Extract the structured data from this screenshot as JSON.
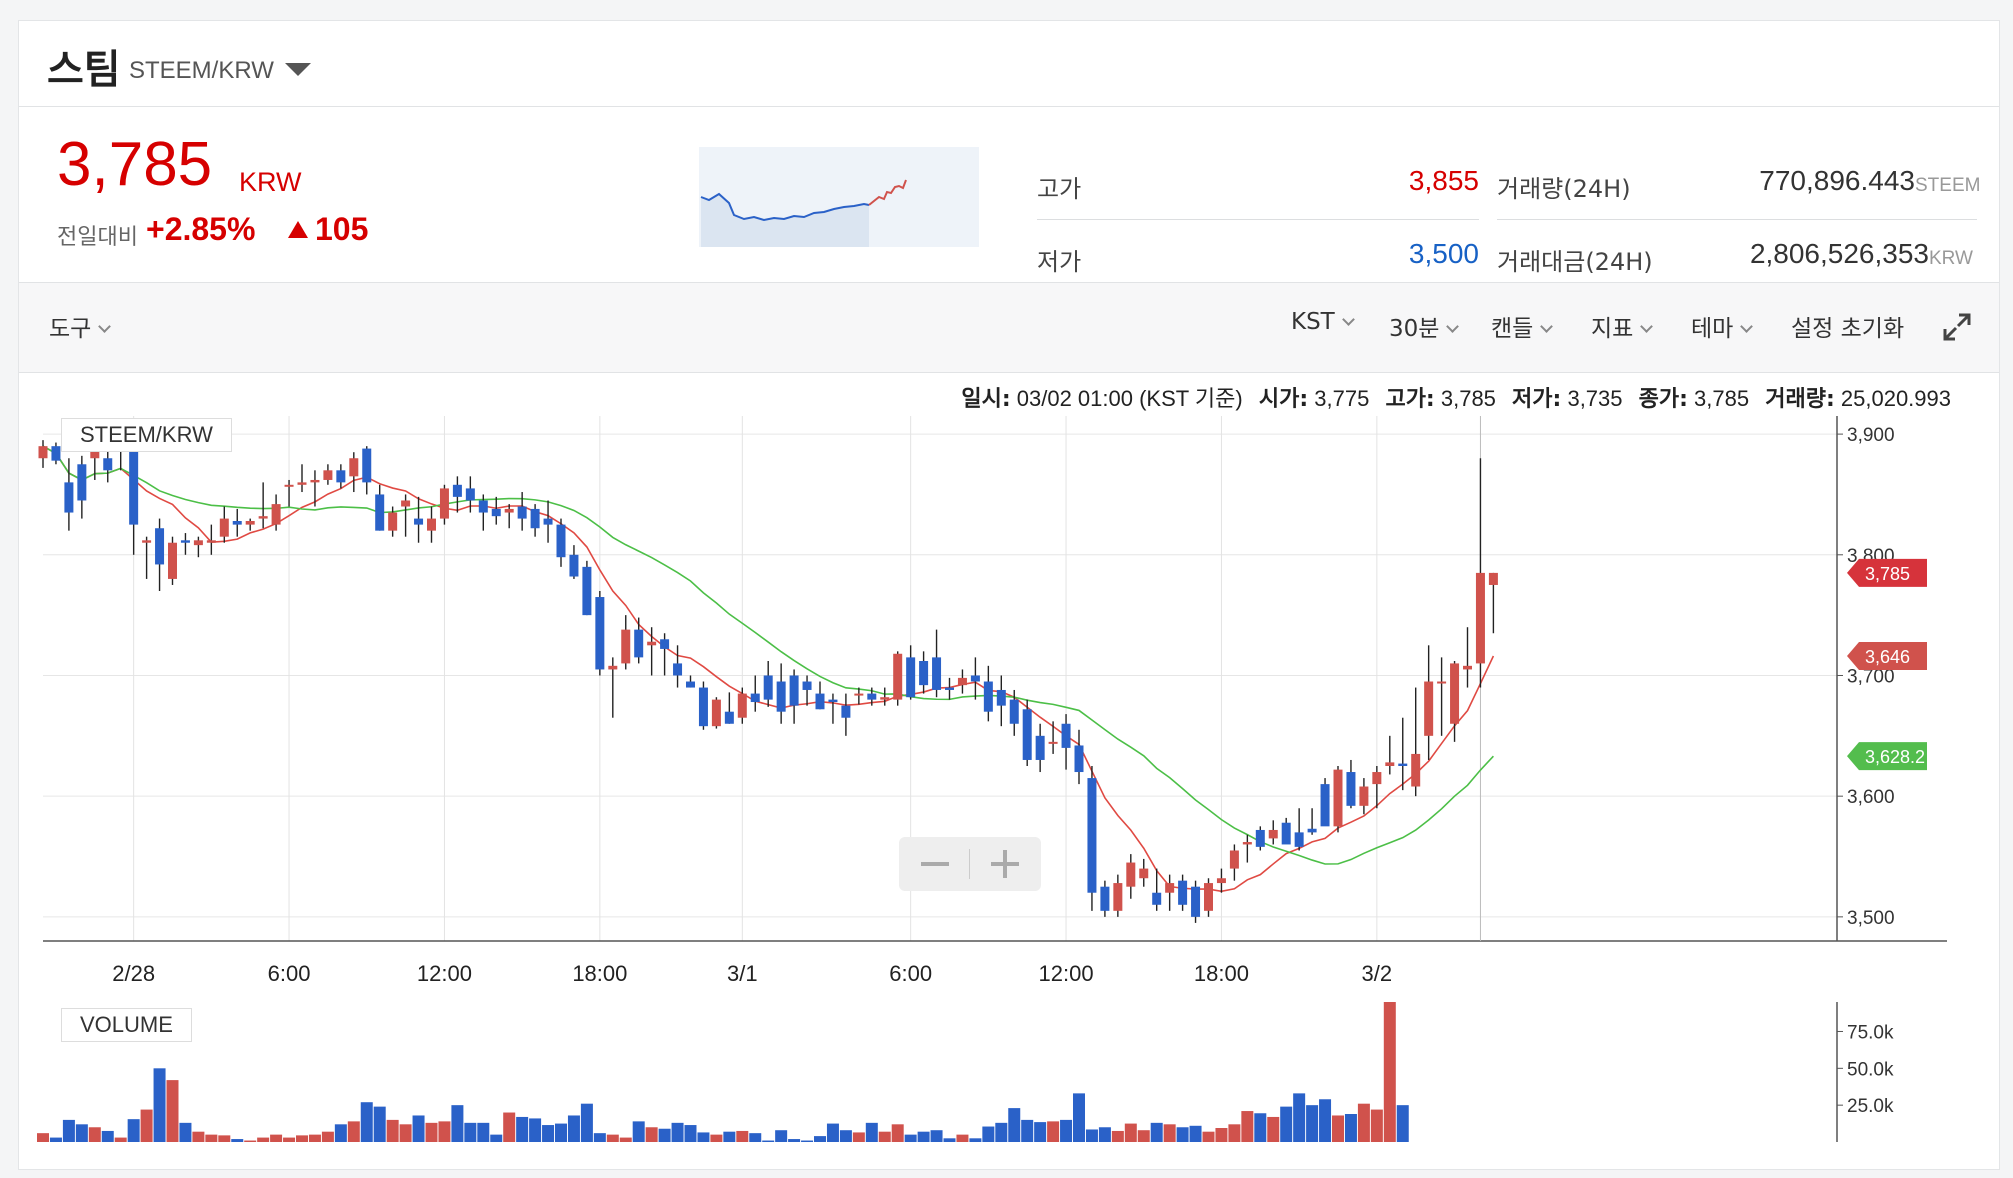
{
  "header": {
    "coin_name": "스팀",
    "pair": "STEEM/KRW"
  },
  "summary": {
    "price": "3,785",
    "unit": "KRW",
    "change_label": "전일대비",
    "change_rate": "+2.85%",
    "change_amount": "105",
    "high_label": "고가",
    "high_value": "3,855",
    "low_label": "저가",
    "low_value": "3,500",
    "volume_label": "거래량(24H)",
    "volume_value": "770,896.443",
    "volume_unit": "STEEM",
    "amount_label": "거래대금(24H)",
    "amount_value": "2,806,526,353",
    "amount_unit": "KRW"
  },
  "toolbar": {
    "tools": "도구",
    "timezone": "KST",
    "interval": "30분",
    "chart_type": "캔들",
    "indicator": "지표",
    "theme": "테마",
    "reset": "설정 초기화"
  },
  "info": {
    "date_label": "일시:",
    "date_value": "03/02 01:00 (KST 기준)",
    "open_label": "시가:",
    "open_value": "3,775",
    "high_label": "고가:",
    "high_value": "3,785",
    "low_label": "저가:",
    "low_value": "3,735",
    "close_label": "종가:",
    "close_value": "3,785",
    "volume_label": "거래량:",
    "volume_value": "25,020.993"
  },
  "legends": {
    "price": "STEEM/KRW",
    "volume": "VOLUME"
  },
  "colors": {
    "up": "#d0524c",
    "down": "#2a61c8",
    "ma_short": "#e04a43",
    "ma_long": "#4cbf47",
    "price_tag": "#d6333b",
    "ma_short_tag": "#d0524c",
    "ma_long_tag": "#53bd4d"
  },
  "chart_data": {
    "type": "candlestick",
    "price_axis": {
      "ylim": [
        3480,
        3915
      ],
      "ticks": [
        3500,
        3600,
        3700,
        3800,
        3900
      ],
      "tick_labels": [
        "3,500",
        "3,600",
        "3,700",
        "3,800",
        "3,900"
      ]
    },
    "x_ticks": [
      {
        "label": "2/28",
        "index": 7
      },
      {
        "label": "6:00",
        "index": 19
      },
      {
        "label": "12:00",
        "index": 31
      },
      {
        "label": "18:00",
        "index": 43
      },
      {
        "label": "3/1",
        "index": 54
      },
      {
        "label": "6:00",
        "index": 67
      },
      {
        "label": "12:00",
        "index": 79
      },
      {
        "label": "18:00",
        "index": 91
      },
      {
        "label": "3/2",
        "index": 103
      }
    ],
    "last_price_tag": "3,785",
    "ma_tags": [
      {
        "name": "MA short",
        "value": "3,646"
      },
      {
        "name": "MA long",
        "value": "3,628.2"
      }
    ],
    "volume_axis": {
      "ylim": [
        0,
        95000
      ],
      "ticks": [
        25000,
        50000,
        75000
      ],
      "tick_labels": [
        "25.0k",
        "50.0k",
        "75.0k"
      ]
    },
    "candles": [
      [
        3880,
        3895,
        3872,
        3890
      ],
      [
        3890,
        3893,
        3875,
        3878
      ],
      [
        3860,
        3880,
        3820,
        3835
      ],
      [
        3875,
        3882,
        3830,
        3845
      ],
      [
        3880,
        3890,
        3862,
        3888
      ],
      [
        3880,
        3895,
        3860,
        3870
      ],
      [
        3890,
        3900,
        3870,
        3895
      ],
      [
        3890,
        3895,
        3800,
        3825
      ],
      [
        3810,
        3815,
        3780,
        3812
      ],
      [
        3822,
        3830,
        3770,
        3792
      ],
      [
        3780,
        3815,
        3775,
        3810
      ],
      [
        3812,
        3818,
        3800,
        3810
      ],
      [
        3808,
        3815,
        3798,
        3812
      ],
      [
        3810,
        3825,
        3800,
        3812
      ],
      [
        3815,
        3840,
        3810,
        3830
      ],
      [
        3828,
        3838,
        3815,
        3825
      ],
      [
        3825,
        3830,
        3820,
        3828
      ],
      [
        3830,
        3860,
        3822,
        3832
      ],
      [
        3825,
        3850,
        3820,
        3842
      ],
      [
        3858,
        3862,
        3840,
        3858
      ],
      [
        3858,
        3875,
        3852,
        3860
      ],
      [
        3860,
        3870,
        3840,
        3862
      ],
      [
        3862,
        3875,
        3858,
        3870
      ],
      [
        3870,
        3875,
        3855,
        3860
      ],
      [
        3865,
        3885,
        3852,
        3880
      ],
      [
        3888,
        3890,
        3850,
        3860
      ],
      [
        3850,
        3858,
        3820,
        3820
      ],
      [
        3820,
        3840,
        3815,
        3835
      ],
      [
        3840,
        3850,
        3815,
        3845
      ],
      [
        3830,
        3848,
        3810,
        3825
      ],
      [
        3820,
        3840,
        3810,
        3830
      ],
      [
        3830,
        3858,
        3825,
        3855
      ],
      [
        3858,
        3865,
        3835,
        3848
      ],
      [
        3855,
        3865,
        3835,
        3845
      ],
      [
        3845,
        3850,
        3820,
        3835
      ],
      [
        3838,
        3848,
        3825,
        3832
      ],
      [
        3835,
        3842,
        3822,
        3838
      ],
      [
        3840,
        3852,
        3820,
        3830
      ],
      [
        3838,
        3842,
        3815,
        3822
      ],
      [
        3830,
        3845,
        3810,
        3825
      ],
      [
        3825,
        3830,
        3790,
        3798
      ],
      [
        3800,
        3808,
        3780,
        3782
      ],
      [
        3790,
        3795,
        3750,
        3750
      ],
      [
        3765,
        3770,
        3700,
        3705
      ],
      [
        3705,
        3715,
        3665,
        3708
      ],
      [
        3710,
        3750,
        3705,
        3738
      ],
      [
        3738,
        3748,
        3710,
        3715
      ],
      [
        3725,
        3740,
        3700,
        3728
      ],
      [
        3730,
        3735,
        3700,
        3722
      ],
      [
        3710,
        3725,
        3690,
        3700
      ],
      [
        3695,
        3700,
        3690,
        3690
      ],
      [
        3690,
        3695,
        3655,
        3658
      ],
      [
        3658,
        3682,
        3656,
        3680
      ],
      [
        3670,
        3686,
        3660,
        3660
      ],
      [
        3665,
        3690,
        3660,
        3685
      ],
      [
        3685,
        3700,
        3670,
        3678
      ],
      [
        3700,
        3712,
        3674,
        3680
      ],
      [
        3695,
        3710,
        3660,
        3670
      ],
      [
        3700,
        3705,
        3660,
        3675
      ],
      [
        3695,
        3700,
        3675,
        3688
      ],
      [
        3685,
        3695,
        3672,
        3672
      ],
      [
        3680,
        3685,
        3660,
        3678
      ],
      [
        3675,
        3685,
        3650,
        3665
      ],
      [
        3685,
        3690,
        3676,
        3685
      ],
      [
        3685,
        3690,
        3675,
        3680
      ],
      [
        3680,
        3690,
        3675,
        3682
      ],
      [
        3680,
        3720,
        3675,
        3718
      ],
      [
        3715,
        3725,
        3680,
        3682
      ],
      [
        3712,
        3720,
        3685,
        3692
      ],
      [
        3715,
        3738,
        3682,
        3688
      ],
      [
        3690,
        3698,
        3680,
        3688
      ],
      [
        3692,
        3705,
        3685,
        3698
      ],
      [
        3700,
        3715,
        3680,
        3695
      ],
      [
        3695,
        3708,
        3662,
        3670
      ],
      [
        3688,
        3700,
        3658,
        3675
      ],
      [
        3680,
        3688,
        3650,
        3660
      ],
      [
        3672,
        3680,
        3625,
        3630
      ],
      [
        3650,
        3660,
        3620,
        3630
      ],
      [
        3645,
        3662,
        3635,
        3645
      ],
      [
        3660,
        3668,
        3622,
        3640
      ],
      [
        3642,
        3655,
        3610,
        3620
      ],
      [
        3615,
        3625,
        3505,
        3520
      ],
      [
        3525,
        3530,
        3500,
        3505
      ],
      [
        3505,
        3535,
        3500,
        3528
      ],
      [
        3525,
        3552,
        3515,
        3545
      ],
      [
        3532,
        3548,
        3525,
        3540
      ],
      [
        3520,
        3540,
        3505,
        3510
      ],
      [
        3520,
        3535,
        3505,
        3528
      ],
      [
        3530,
        3535,
        3505,
        3510
      ],
      [
        3525,
        3530,
        3495,
        3500
      ],
      [
        3505,
        3532,
        3500,
        3528
      ],
      [
        3528,
        3540,
        3520,
        3532
      ],
      [
        3540,
        3560,
        3530,
        3555
      ],
      [
        3560,
        3568,
        3545,
        3562
      ],
      [
        3572,
        3575,
        3555,
        3558
      ],
      [
        3565,
        3580,
        3560,
        3572
      ],
      [
        3578,
        3582,
        3562,
        3560
      ],
      [
        3570,
        3590,
        3555,
        3558
      ],
      [
        3573,
        3590,
        3568,
        3570
      ],
      [
        3610,
        3615,
        3580,
        3575
      ],
      [
        3575,
        3625,
        3570,
        3622
      ],
      [
        3620,
        3630,
        3590,
        3592
      ],
      [
        3592,
        3615,
        3585,
        3608
      ],
      [
        3610,
        3625,
        3590,
        3620
      ],
      [
        3625,
        3650,
        3618,
        3628
      ],
      [
        3627,
        3665,
        3605,
        3625
      ],
      [
        3608,
        3690,
        3600,
        3635
      ],
      [
        3650,
        3725,
        3630,
        3695
      ],
      [
        3695,
        3715,
        3650,
        3695
      ],
      [
        3660,
        3712,
        3645,
        3710
      ],
      [
        3705,
        3740,
        3690,
        3708
      ],
      [
        3710,
        3880,
        3690,
        3785
      ],
      [
        3775,
        3785,
        3735,
        3785
      ]
    ],
    "volumes": [
      6000,
      3000,
      15000,
      12000,
      10000,
      7500,
      3000,
      15500,
      22000,
      50000,
      42000,
      13000,
      7000,
      5000,
      4500,
      2000,
      1000,
      3000,
      5000,
      3000,
      4500,
      5000,
      7000,
      12000,
      14000,
      27000,
      24000,
      15000,
      12000,
      18000,
      13000,
      14000,
      25000,
      13000,
      13000,
      5000,
      20000,
      17000,
      16000,
      11500,
      12500,
      18000,
      26000,
      6000,
      5000,
      3000,
      14000,
      10000,
      9000,
      13000,
      11500,
      6500,
      5000,
      7000,
      7500,
      6000,
      1000,
      8000,
      2000,
      1000,
      4000,
      12500,
      8000,
      6500,
      13000,
      7000,
      12000,
      5000,
      7000,
      8000,
      2500,
      5000,
      2500,
      10500,
      13000,
      23000,
      15000,
      13500,
      14000,
      15000,
      33000,
      8500,
      10000,
      7500,
      12500,
      8000,
      13000,
      12000,
      10000,
      11000,
      7000,
      9500,
      12000,
      21000,
      19500,
      17000,
      24000,
      33000,
      25000,
      29000,
      18000,
      19000,
      26000,
      22000,
      97000,
      25000
    ]
  }
}
